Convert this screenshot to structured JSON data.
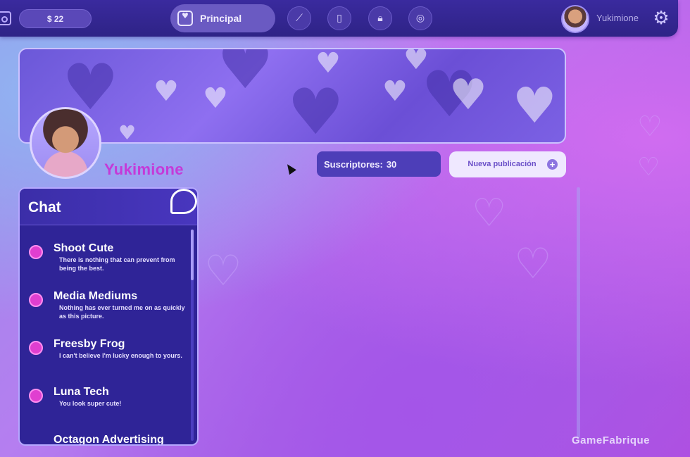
{
  "topbar": {
    "money": "$ 22",
    "nav_principal": "Principal",
    "nav_icons": [
      "stats-icon",
      "phone-icon",
      "lock-icon",
      "settings-wheel-icon"
    ],
    "username": "Yukimione"
  },
  "profile": {
    "name": "Yukimione",
    "subscribers_label": "Suscriptores:",
    "subscribers_value": "30",
    "new_post_label": "Nueva publicación"
  },
  "chat": {
    "title": "Chat",
    "items": [
      {
        "name": "Shoot Cute",
        "message": "There is nothing that can prevent from being the best."
      },
      {
        "name": "Media Mediums",
        "message": "Nothing has ever turned me on as quickly as this picture."
      },
      {
        "name": "Freesby Frog",
        "message": "I can't believe I'm lucky enough to yours."
      },
      {
        "name": "Luna Tech",
        "message": "You look super cute!"
      },
      {
        "name": "Octagon Advertising",
        "message": ""
      }
    ]
  },
  "watermark": "GameFabrique",
  "colors": {
    "accent_pink": "#c43ad8",
    "panel_dark": "#2f2497",
    "topbar": "#3a2a9e"
  }
}
